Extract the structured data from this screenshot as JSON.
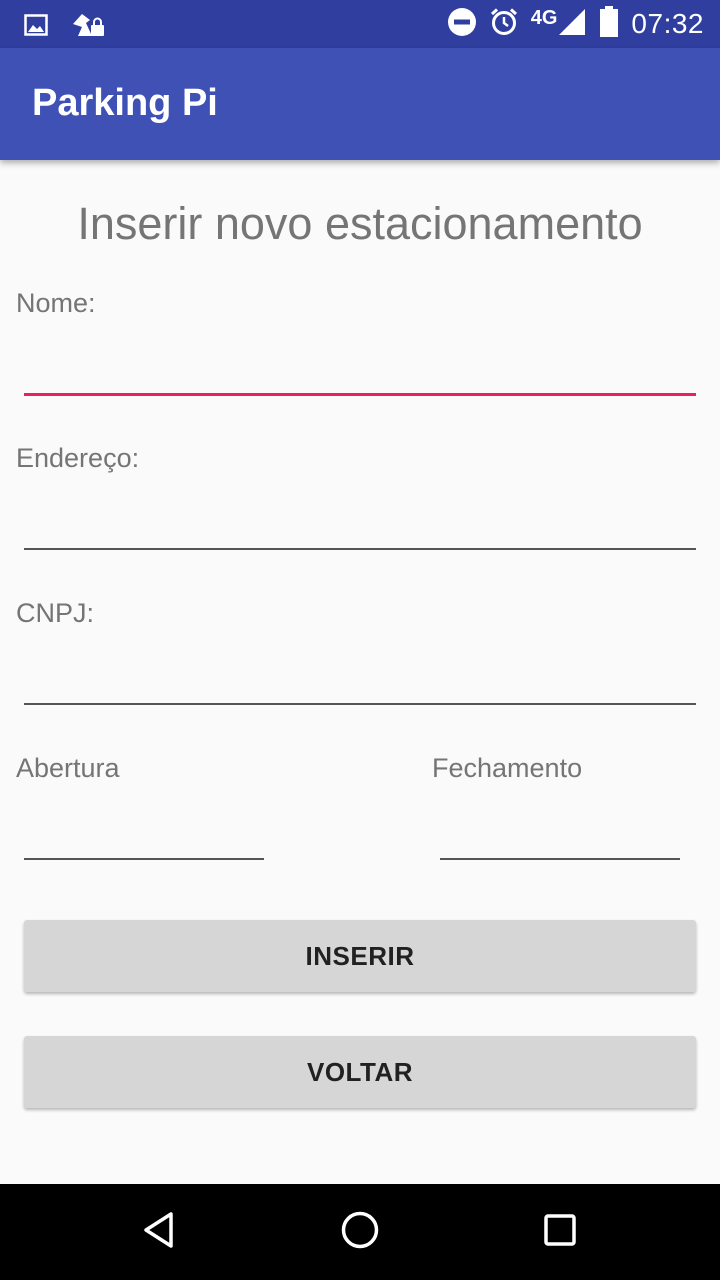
{
  "status_bar": {
    "time": "07:32",
    "network": "4G",
    "icons": [
      "image-notification-icon",
      "vpn-lock-icon",
      "do-not-disturb-icon",
      "alarm-icon",
      "signal-icon",
      "battery-icon"
    ]
  },
  "app_bar": {
    "title": "Parking Pi",
    "color": "#3f51b5"
  },
  "form": {
    "heading": "Inserir novo estacionamento",
    "nome_label": "Nome:",
    "nome_value": "",
    "endereco_label": "Endereço:",
    "endereco_value": "",
    "cnpj_label": "CNPJ:",
    "cnpj_value": "",
    "abertura_label": "Abertura",
    "abertura_value": "",
    "fechamento_label": "Fechamento",
    "fechamento_value": "",
    "focus_color": "#e91e63"
  },
  "buttons": {
    "inserir": "INSERIR",
    "voltar": "VOLTAR"
  },
  "nav_bar": {
    "icons": [
      "back-icon",
      "home-icon",
      "recents-icon"
    ]
  }
}
